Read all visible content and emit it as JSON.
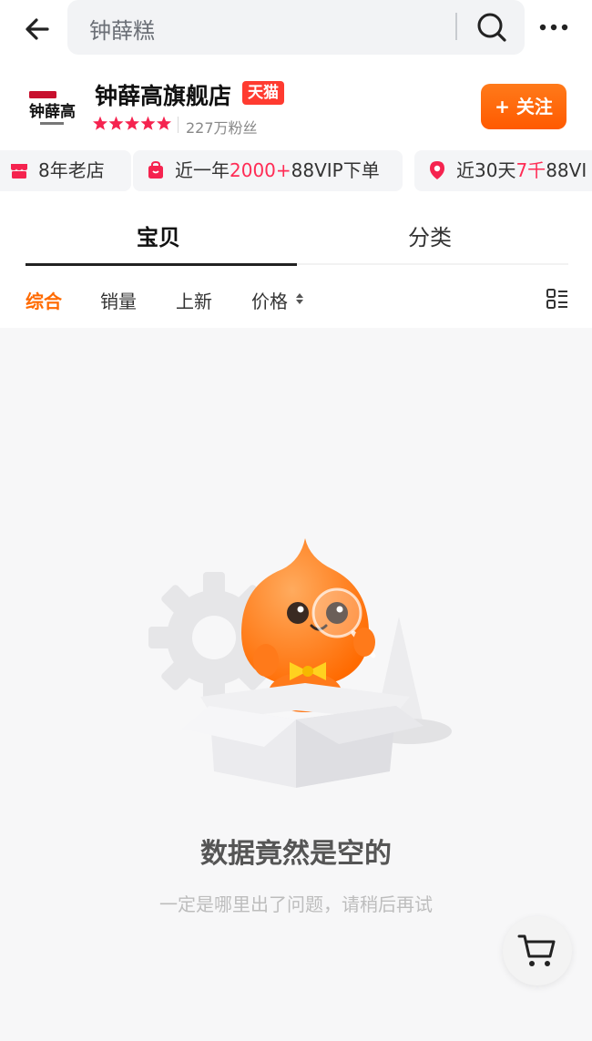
{
  "search": {
    "query": "钟薛糕"
  },
  "store": {
    "name": "钟薛高旗舰店",
    "badge": "天猫",
    "fans": "227万粉丝",
    "follow_label": "+ 关注",
    "rating_stars": 5,
    "logo_text": "钟薛高"
  },
  "tags": [
    {
      "pre": "8年老店",
      "hl": "",
      "post": ""
    },
    {
      "pre": "近一年",
      "hl": "2000+",
      "post": "88VIP下单"
    },
    {
      "pre": "近30天",
      "hl": "7千",
      "post": "88VI"
    }
  ],
  "tabs": [
    {
      "label": "宝贝",
      "active": true
    },
    {
      "label": "分类",
      "active": false
    }
  ],
  "sort": [
    "综合",
    "销量",
    "上新",
    "价格"
  ],
  "empty": {
    "title": "数据竟然是空的",
    "subtitle": "一定是哪里出了问题，请稍后再试"
  },
  "colors": {
    "accent": "#ff6a00",
    "tmall_red": "#ff3b30",
    "highlight": "#ff2c55"
  },
  "icons": [
    "back-arrow-icon",
    "search-icon",
    "more-icon",
    "star-icon",
    "shop-icon",
    "bag-icon",
    "location-pin-icon",
    "sort-arrows-icon",
    "layout-toggle-icon",
    "cart-icon"
  ]
}
